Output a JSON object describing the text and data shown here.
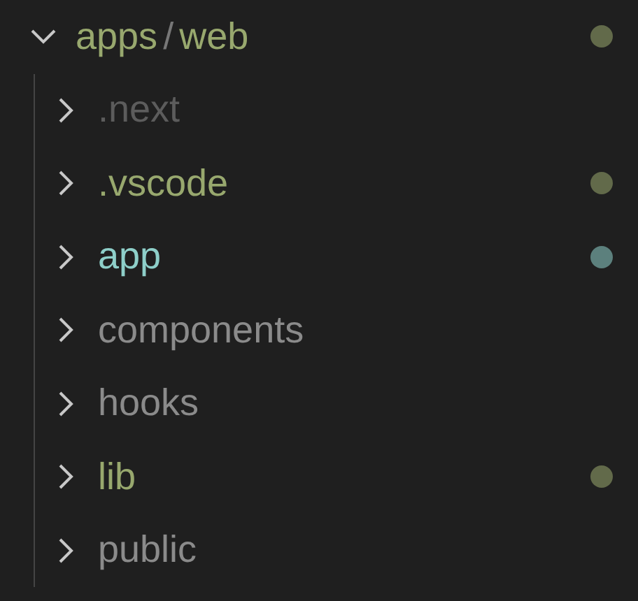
{
  "tree": {
    "label": "apps",
    "separator": "/",
    "label_2": "web",
    "expanded": true,
    "color": "#98a86e",
    "dot": true,
    "children": [
      {
        "label": ".next",
        "expanded": false,
        "color": "#5c5c5c",
        "dot": false
      },
      {
        "label": ".vscode",
        "expanded": false,
        "color": "#98a86e",
        "dot": true
      },
      {
        "label": "app",
        "expanded": false,
        "color": "#8ecfc9",
        "dot": true
      },
      {
        "label": "components",
        "expanded": false,
        "color": "#8b8b8b",
        "dot": false
      },
      {
        "label": "hooks",
        "expanded": false,
        "color": "#8b8b8b",
        "dot": false
      },
      {
        "label": "lib",
        "expanded": false,
        "color": "#98a86e",
        "dot": true
      },
      {
        "label": "public",
        "expanded": false,
        "color": "#8b8b8b",
        "dot": false
      }
    ]
  }
}
